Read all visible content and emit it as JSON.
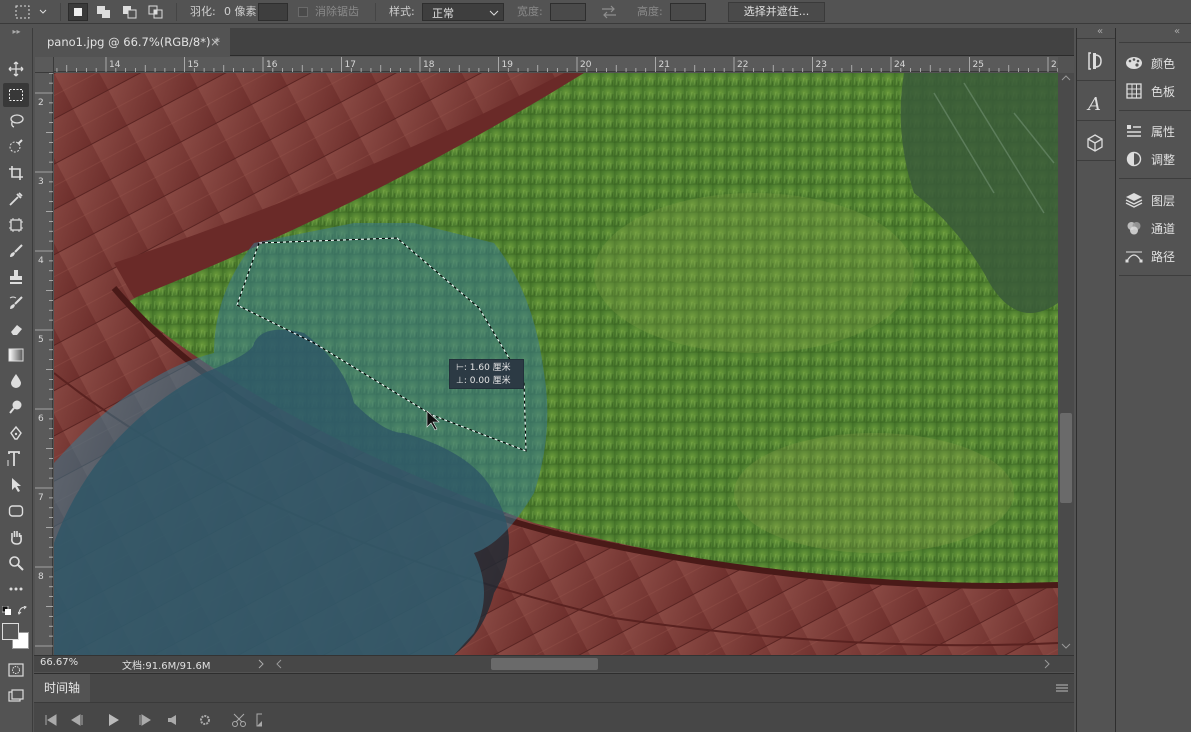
{
  "options": {
    "feather_label": "羽化:",
    "feather_value": "0 像素",
    "antialias_label": "消除锯齿",
    "style_label": "样式:",
    "style_value": "正常",
    "width_label": "宽度:",
    "height_label": "高度:",
    "select_mask_button": "选择并遮住..."
  },
  "document": {
    "tab_title": "pano1.jpg @ 66.7%(RGB/8*) *",
    "close_glyph": "×"
  },
  "ruler": {
    "h_labels": [
      "14",
      "15",
      "16",
      "17",
      "18",
      "19",
      "20",
      "21",
      "22",
      "23",
      "24",
      "25",
      "2"
    ],
    "v_labels": [
      "2",
      "3",
      "4",
      "5",
      "6",
      "7",
      "8"
    ]
  },
  "tooltip": {
    "line1_icon": "⊢:",
    "line1_value": "1.60 厘米",
    "line2_icon": "⊥:",
    "line2_value": "0.00 厘米"
  },
  "status": {
    "zoom": "66.67%",
    "doc_info": "文档:91.6M/91.6M"
  },
  "timeline": {
    "tab_label": "时间轴"
  },
  "panels": {
    "items": [
      {
        "label": "颜色",
        "icon": "palette-icon"
      },
      {
        "label": "色板",
        "icon": "swatches-grid-icon"
      },
      {
        "label": "属性",
        "icon": "properties-sliders-icon"
      },
      {
        "label": "调整",
        "icon": "adjustments-circle-icon"
      },
      {
        "label": "图层",
        "icon": "layers-stack-icon"
      },
      {
        "label": "通道",
        "icon": "channels-rgb-icon"
      },
      {
        "label": "路径",
        "icon": "paths-pen-icon"
      }
    ],
    "collapse_glyph": "«"
  },
  "colors": {
    "ui_bg": "#535353",
    "ui_dark": "#424242",
    "grass": "#4a7a2c",
    "deck": "#7a3a34",
    "quickmask_overlay": "#2a6a80"
  }
}
